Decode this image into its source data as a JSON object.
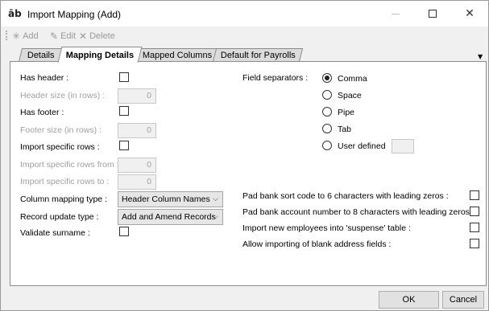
{
  "window": {
    "app_icon_text": "āb",
    "title": "Import Mapping (Add)",
    "controls": {
      "minimize": "—",
      "maximize": "□",
      "close": "✕"
    }
  },
  "toolbar": {
    "add_label": "Add",
    "add_icon": "✳",
    "edit_label": "Edit",
    "edit_icon": "✎",
    "delete_label": "Delete",
    "delete_icon": "✕"
  },
  "tabs": [
    {
      "label": "Details",
      "active": false
    },
    {
      "label": "Mapping Details",
      "active": true
    },
    {
      "label": "Mapped Columns",
      "active": false
    },
    {
      "label": "Default for Payrolls",
      "active": false
    }
  ],
  "tab_overflow_icon": "▼",
  "left_fields": {
    "has_header": {
      "label": "Has header :",
      "checked": false
    },
    "header_size": {
      "label": "Header size (in rows) :",
      "value": "0",
      "enabled": false
    },
    "has_footer": {
      "label": "Has footer :",
      "checked": false
    },
    "footer_size": {
      "label": "Footer size (in rows) :",
      "value": "0",
      "enabled": false
    },
    "import_specific_rows": {
      "label": "Import specific rows :",
      "checked": false
    },
    "rows_from": {
      "label": "Import specific rows from :",
      "value": "0",
      "enabled": false
    },
    "rows_to": {
      "label": "Import specific rows to :",
      "value": "0",
      "enabled": false
    },
    "column_mapping_type": {
      "label": "Column mapping type :",
      "value": "Header Column Names"
    },
    "record_update_type": {
      "label": "Record update type :",
      "value": "Add and Amend Records"
    },
    "validate_surname": {
      "label": "Validate surname :",
      "checked": false
    }
  },
  "field_separators": {
    "label": "Field separators :",
    "options": [
      {
        "label": "Comma",
        "selected": true
      },
      {
        "label": "Space",
        "selected": false
      },
      {
        "label": "Pipe",
        "selected": false
      },
      {
        "label": "Tab",
        "selected": false
      },
      {
        "label": "User defined",
        "selected": false
      }
    ]
  },
  "right_options": [
    {
      "label": "Pad bank sort code to 6 characters with leading zeros :",
      "checked": false
    },
    {
      "label": "Pad bank account number to 8 characters with leading zeros :",
      "checked": false
    },
    {
      "label": "Import new employees into 'suspense' table :",
      "checked": false
    },
    {
      "label": "Allow importing of blank address fields :",
      "checked": false
    }
  ],
  "buttons": {
    "ok": "OK",
    "cancel": "Cancel"
  },
  "dropdown_chevron": "⌵"
}
